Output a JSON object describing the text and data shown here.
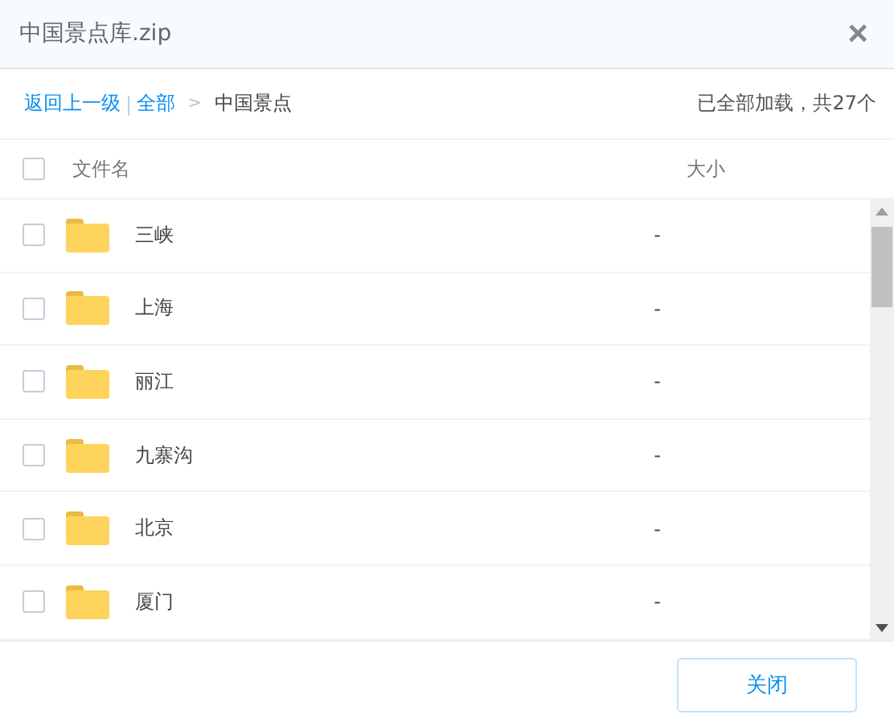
{
  "window": {
    "title": "中国景点库.zip",
    "close": "×"
  },
  "breadcrumb": {
    "back": "返回上一级",
    "separator": "|",
    "root": "全部",
    "arrow": ">",
    "current": "中国景点",
    "status": "已全部加载，共27个"
  },
  "table": {
    "select_all": {
      "checked": false
    },
    "columns": [
      "文件名",
      "大小"
    ],
    "rows": [
      {
        "name": "三峡",
        "size": "-",
        "checked": false
      },
      {
        "name": "上海",
        "size": "-",
        "checked": false
      },
      {
        "name": "丽江",
        "size": "-",
        "checked": false
      },
      {
        "name": "九寨沟",
        "size": "-",
        "checked": false
      },
      {
        "name": "北京",
        "size": "-",
        "checked": false
      },
      {
        "name": "厦门",
        "size": "-",
        "checked": false
      }
    ]
  },
  "buttons": [
    "关闭"
  ]
}
